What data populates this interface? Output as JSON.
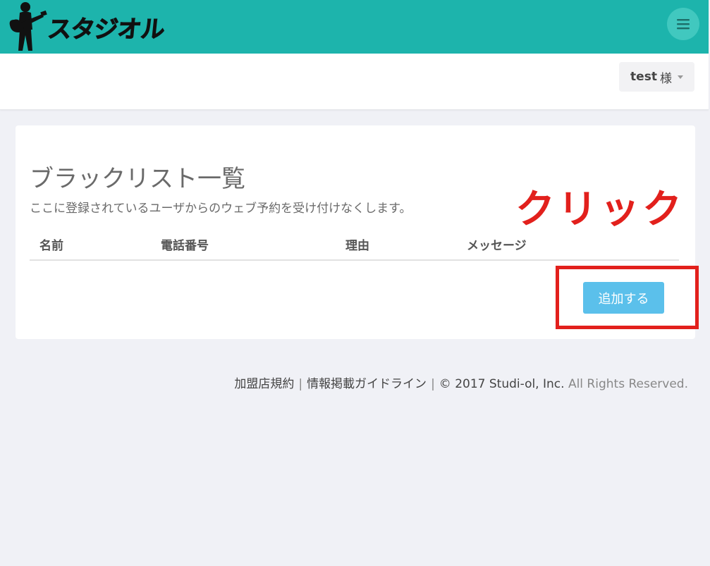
{
  "header": {
    "logo_text": "スタジオル",
    "bg_color": "#1db4ac",
    "menu_icon": "hamburger-icon"
  },
  "user_menu": {
    "name": "test",
    "honorific": "様"
  },
  "main": {
    "title": "ブラックリスト一覧",
    "description": "ここに登録されているユーザからのウェブ予約を受け付けなくします。",
    "columns": [
      "名前",
      "電話番号",
      "理由",
      "メッセージ"
    ],
    "rows": [],
    "add_button_label": "追加する"
  },
  "annotation": {
    "text": "クリック",
    "color": "#e2201c"
  },
  "footer": {
    "links": [
      "加盟店規約",
      "情報掲載ガイドライン"
    ],
    "separator": "|",
    "copyright": "© 2017 Studi-ol, Inc.",
    "rights": "All Rights Reserved."
  }
}
